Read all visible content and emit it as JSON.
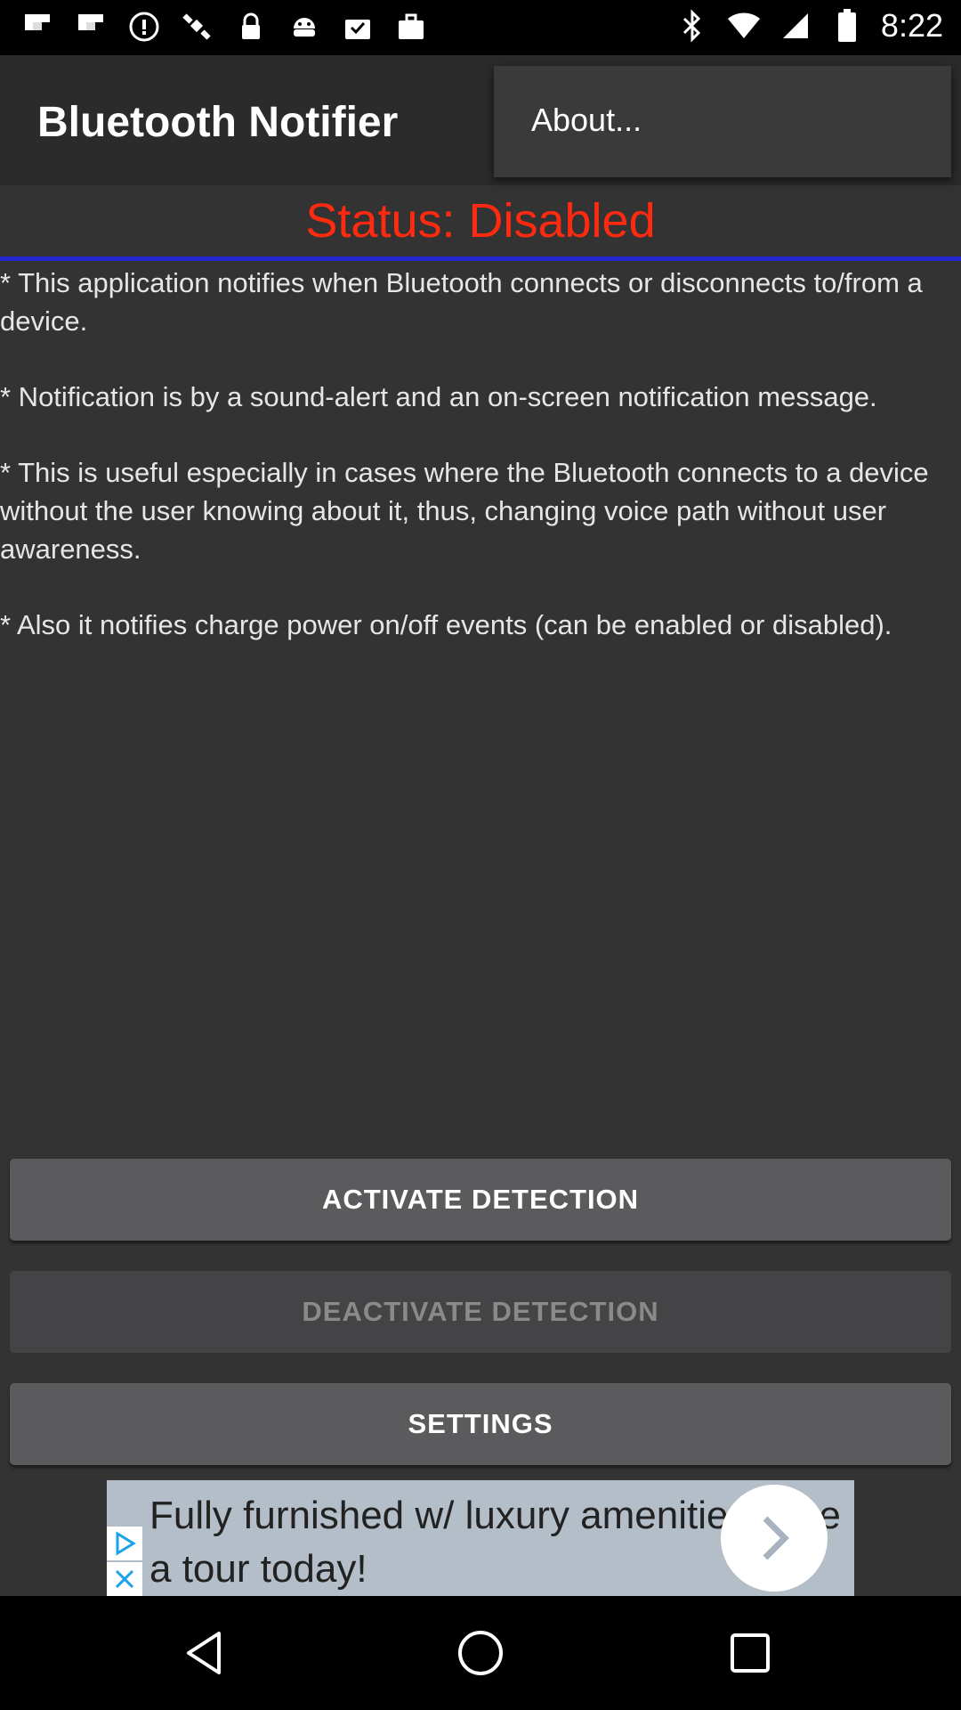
{
  "status_bar": {
    "time": "8:22",
    "left_icons": [
      "flipboard-icon",
      "flipboard-icon",
      "info-circle-icon",
      "satellite-icon",
      "lock-icon",
      "android-icon",
      "inbox-check-icon",
      "briefcase-icon"
    ],
    "right_icons": [
      "bluetooth-icon",
      "wifi-icon",
      "signal-icon",
      "battery-icon"
    ]
  },
  "action_bar": {
    "title": "Bluetooth Notifier",
    "menu_item": "About..."
  },
  "status_text": "Status: Disabled",
  "colors": {
    "status": "#ff2a10",
    "divider": "#2525d0",
    "background": "#333333"
  },
  "description": [
    "* This application notifies when Bluetooth connects or disconnects to/from a device.",
    "* Notification is by a sound-alert and an on-screen notification message.",
    "* This is useful especially in cases where the Bluetooth connects to a device without the user knowing about it, thus, changing voice path without user awareness.",
    "* Also it notifies charge power on/off events (can be enabled or disabled)."
  ],
  "buttons": {
    "activate": "ACTIVATE DETECTION",
    "deactivate": "DEACTIVATE DETECTION",
    "settings": "SETTINGS"
  },
  "ad": {
    "text": "Fully furnished w/ luxury amenities Take a tour today!"
  },
  "nav": [
    "back-icon",
    "home-icon",
    "recents-icon"
  ]
}
